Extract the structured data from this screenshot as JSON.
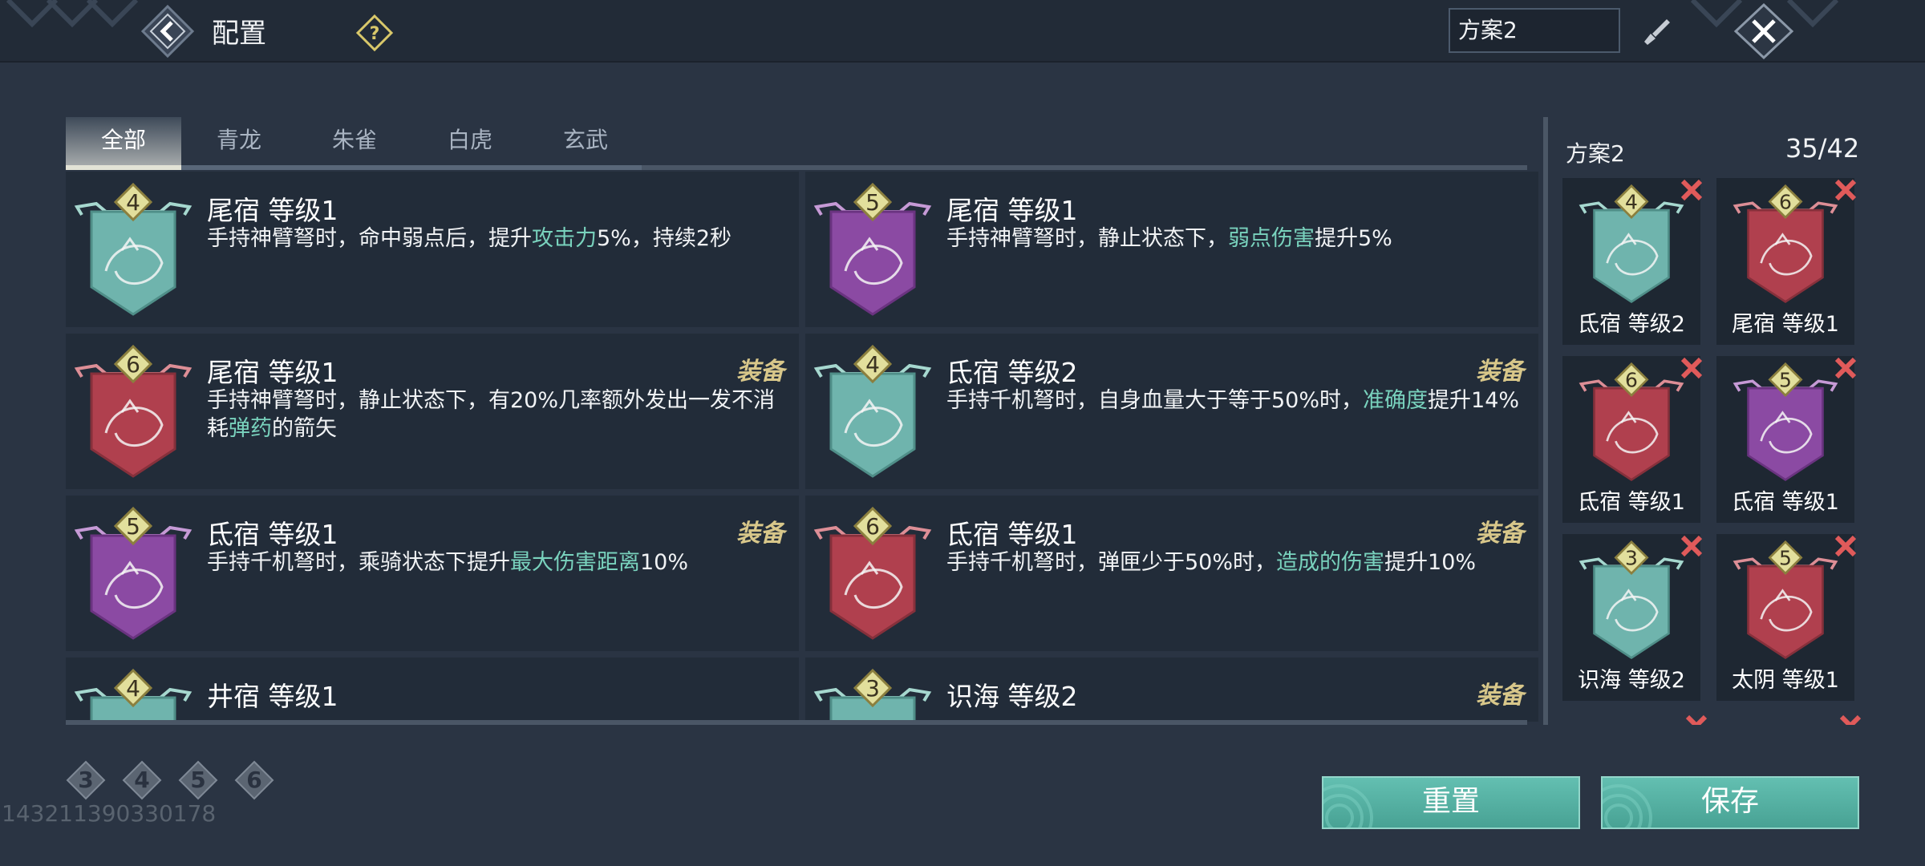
{
  "header": {
    "title": "配置",
    "plan_name": "方案2",
    "back_icon": "back-arrow-icon",
    "help_icon": "question-icon",
    "edit_icon": "brush-icon",
    "close_icon": "close-icon"
  },
  "tabs": [
    {
      "label": "全部",
      "active": true
    },
    {
      "label": "青龙",
      "active": false
    },
    {
      "label": "朱雀",
      "active": false
    },
    {
      "label": "白虎",
      "active": false
    },
    {
      "label": "玄武",
      "active": false
    }
  ],
  "cards": [
    {
      "level": "4",
      "name": "尾宿 等级1",
      "color": "teal",
      "desc_pre": "手持神臂弩时，命中弱点后，提升",
      "highlight": "攻击力",
      "desc_post": "5%，持续2秒",
      "equip": ""
    },
    {
      "level": "5",
      "name": "尾宿 等级1",
      "color": "purple",
      "desc_pre": "手持神臂弩时，静止状态下，",
      "highlight": "弱点伤害",
      "desc_post": "提升5%",
      "equip": ""
    },
    {
      "level": "6",
      "name": "尾宿 等级1",
      "color": "red",
      "desc_pre": "手持神臂弩时，静止状态下，有20%几率额外发出一发不消耗",
      "highlight": "弹药",
      "desc_post": "的箭矢",
      "equip": "装备"
    },
    {
      "level": "4",
      "name": "氐宿 等级2",
      "color": "teal",
      "desc_pre": "手持千机弩时，自身血量大于等于50%时，",
      "highlight": "准确度",
      "desc_post": "提升14%",
      "equip": "装备"
    },
    {
      "level": "5",
      "name": "氐宿 等级1",
      "color": "purple",
      "desc_pre": "手持千机弩时，乘骑状态下提升",
      "highlight": "最大伤害距离",
      "desc_post": "10%",
      "equip": "装备"
    },
    {
      "level": "6",
      "name": "氐宿 等级1",
      "color": "red",
      "desc_pre": "手持千机弩时，弹匣少于50%时，",
      "highlight": "造成的伤害",
      "desc_post": "提升10%",
      "equip": "装备"
    },
    {
      "level": "4",
      "name": "井宿 等级1",
      "color": "teal",
      "desc_pre": "",
      "highlight": "",
      "desc_post": "",
      "equip": ""
    },
    {
      "level": "3",
      "name": "识海 等级2",
      "color": "teal",
      "desc_pre": "",
      "highlight": "",
      "desc_post": "",
      "equip": "装备"
    }
  ],
  "panel": {
    "title": "方案2",
    "count": "35/42",
    "items": [
      {
        "level": "4",
        "name": "氐宿 等级2",
        "color": "teal"
      },
      {
        "level": "6",
        "name": "尾宿 等级1",
        "color": "red"
      },
      {
        "level": "6",
        "name": "氐宿 等级1",
        "color": "red"
      },
      {
        "level": "5",
        "name": "氐宿 等级1",
        "color": "purple"
      },
      {
        "level": "3",
        "name": "识海 等级2",
        "color": "teal"
      },
      {
        "level": "5",
        "name": "太阴 等级1",
        "color": "red"
      }
    ]
  },
  "filters": [
    "3",
    "4",
    "5",
    "6"
  ],
  "uid": "143211390330178",
  "buttons": {
    "reset": "重置",
    "save": "保存"
  },
  "colors": {
    "teal": "#6fb4ad",
    "purple": "#8b4aa3",
    "red": "#b0404e",
    "highlight": "#79d2bd",
    "accent": "#5bb8a9"
  }
}
